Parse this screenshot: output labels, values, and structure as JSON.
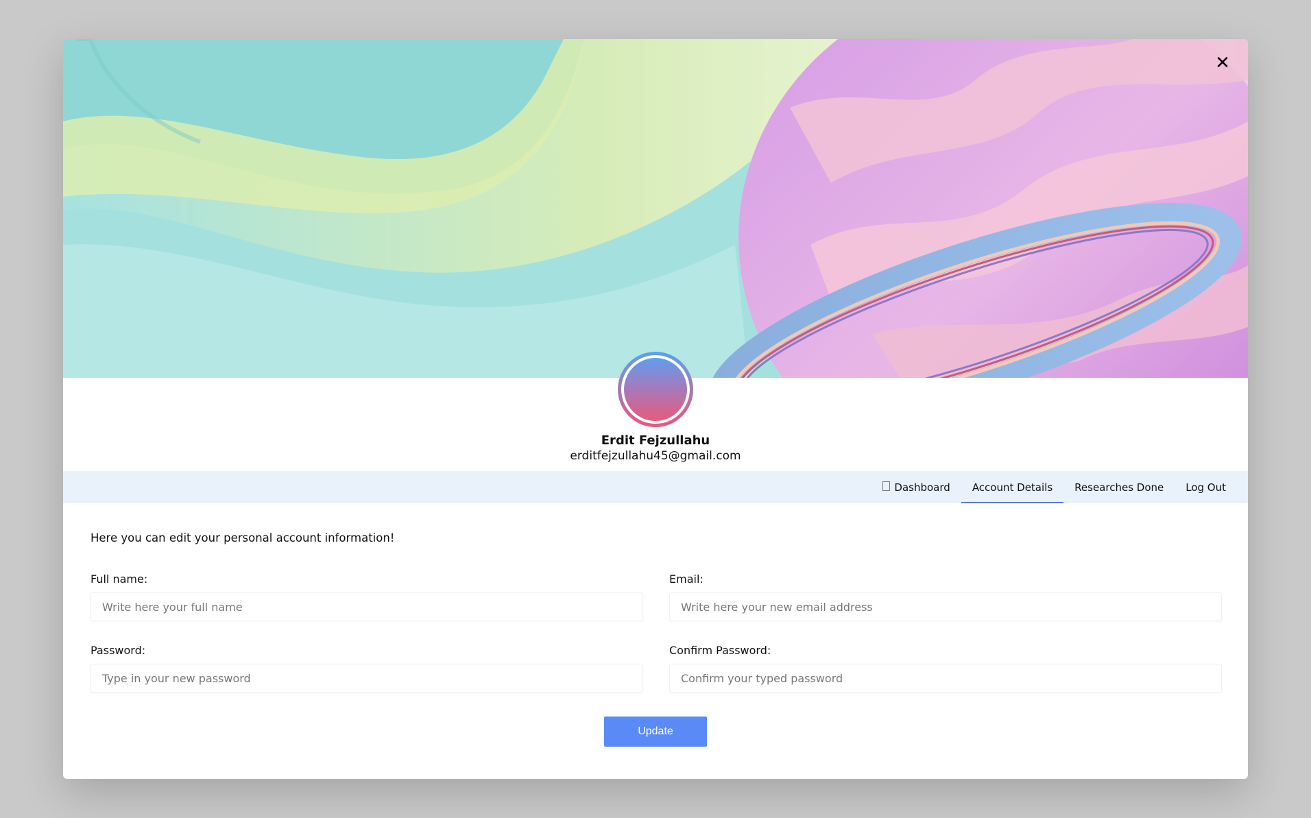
{
  "modal": {
    "close_icon": "close-icon",
    "close_glyph": "✕"
  },
  "profile": {
    "name": "Erdit Fejzullahu",
    "email": "erditfejzullahu45@gmail.com"
  },
  "nav": {
    "items": [
      {
        "label": "Dashboard",
        "icon": "broken-image-icon"
      },
      {
        "label": "Account Details",
        "active": true
      },
      {
        "label": "Researches Done"
      },
      {
        "label": "Log Out"
      }
    ]
  },
  "form": {
    "intro": "Here you can edit your personal account information!",
    "full_name": {
      "label": "Full name:",
      "placeholder": "Write here your full name"
    },
    "email": {
      "label": "Email:",
      "placeholder": "Write here your new email address"
    },
    "password": {
      "label": "Password:",
      "placeholder": "Type in your new password"
    },
    "confirm_password": {
      "label": "Confirm Password:",
      "placeholder": "Confirm your typed password"
    },
    "submit_label": "Update"
  },
  "colors": {
    "accent": "#5a8af6",
    "nav_bg": "#e9f1fb",
    "active_underline": "#5b7ccc",
    "backdrop": "#c9c9c9"
  }
}
